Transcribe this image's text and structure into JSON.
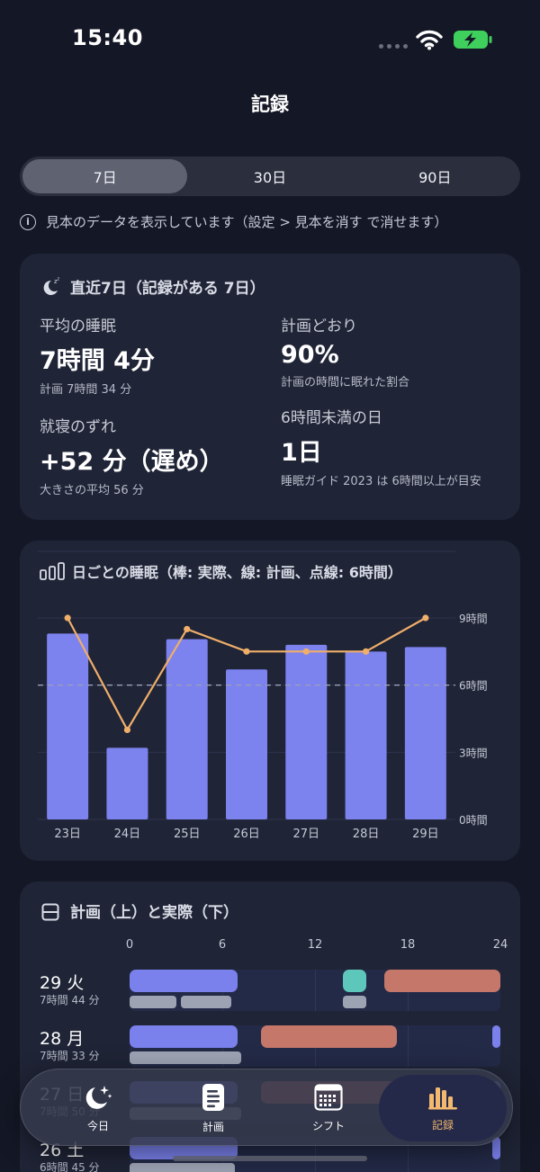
{
  "status": {
    "time": "15:40"
  },
  "nav": {
    "title": "記録"
  },
  "range_tabs": [
    {
      "label": "7日",
      "active": true
    },
    {
      "label": "30日",
      "active": false
    },
    {
      "label": "90日",
      "active": false
    }
  ],
  "notice": "見本のデータを表示しています（設定 > 見本を消す で消せます）",
  "summary": {
    "title": "直近7日（記録がある 7日）",
    "avg_label": "平均の睡眠",
    "avg_value": "7時間 4分",
    "avg_sub": "計画 7時間 34 分",
    "onplan_label": "計画どおり",
    "onplan_value": "90%",
    "onplan_sub": "計画の時間に眠れた割合",
    "drift_label": "就寝のずれ",
    "drift_value": "+52 分（遅め）",
    "drift_sub": "大きさの平均 56 分",
    "short_label": "6時間未満の日",
    "short_value": "1日",
    "short_sub": "睡眠ガイド 2023 は 6時間以上が目安"
  },
  "chart_title": "日ごとの睡眠（棒: 実際、線: 計画、点線: 6時間）",
  "chart_data": {
    "type": "bar",
    "categories": [
      "23日",
      "24日",
      "25日",
      "26日",
      "27日",
      "28日",
      "29日"
    ],
    "series": [
      {
        "name": "実際",
        "type": "bar",
        "values": [
          8.3,
          3.2,
          8.05,
          6.7,
          7.8,
          7.5,
          7.7
        ]
      },
      {
        "name": "計画",
        "type": "line",
        "values": [
          9.0,
          4.0,
          8.5,
          7.5,
          7.5,
          7.5,
          9.0
        ]
      }
    ],
    "reference_line": {
      "name": "6時間",
      "value": 6
    },
    "y_ticks": [
      "0時間",
      "3時間",
      "6時間",
      "9時間"
    ],
    "ylim": [
      0,
      9
    ],
    "colors": {
      "bar": "#7c82ee",
      "line": "#efae6a",
      "reference": "#9aa0b8"
    }
  },
  "timeline": {
    "title": "計画（上）と実際（下）",
    "hours": [
      "0",
      "6",
      "12",
      "18",
      "24"
    ],
    "colors": {
      "sleep": "#7a80ec",
      "work": "#c5776a",
      "teal": "#5ec7bc",
      "actual": "#9ea3b4",
      "track": "#232a47"
    },
    "rows": [
      {
        "day": "29 火",
        "duration": "7時間 44 分",
        "plan": [
          [
            0,
            7,
            "sleep"
          ],
          [
            13.8,
            15.3,
            "teal"
          ],
          [
            16.5,
            24,
            "work"
          ]
        ],
        "actual": [
          [
            0,
            3,
            "actual"
          ],
          [
            3.3,
            6.6,
            "actual"
          ],
          [
            13.8,
            15.3,
            "actual"
          ]
        ]
      },
      {
        "day": "28 月",
        "duration": "7時間 33 分",
        "plan": [
          [
            0,
            7,
            "sleep"
          ],
          [
            8.5,
            17.3,
            "work"
          ],
          [
            23.5,
            24,
            "sleep"
          ]
        ],
        "actual": [
          [
            0,
            7.2,
            "actual"
          ]
        ]
      },
      {
        "day": "27 日",
        "duration": "7時間 50 分",
        "plan": [
          [
            0,
            7,
            "sleep"
          ],
          [
            8.5,
            17.3,
            "work"
          ],
          [
            23.5,
            24,
            "sleep"
          ]
        ],
        "actual": [
          [
            0,
            7.2,
            "actual"
          ]
        ]
      },
      {
        "day": "26 土",
        "duration": "6時間 45 分",
        "plan": [
          [
            0,
            7,
            "sleep"
          ],
          [
            23.5,
            24,
            "sleep"
          ]
        ],
        "actual": [
          [
            0,
            6.8,
            "actual"
          ]
        ]
      }
    ]
  },
  "tabbar": [
    {
      "label": "今日",
      "icon": "moon-stars-icon",
      "active": false
    },
    {
      "label": "計画",
      "icon": "document-list-icon",
      "active": false
    },
    {
      "label": "シフト",
      "icon": "calendar-grid-icon",
      "active": false
    },
    {
      "label": "記録",
      "icon": "bar-chart-icon",
      "active": true
    }
  ]
}
